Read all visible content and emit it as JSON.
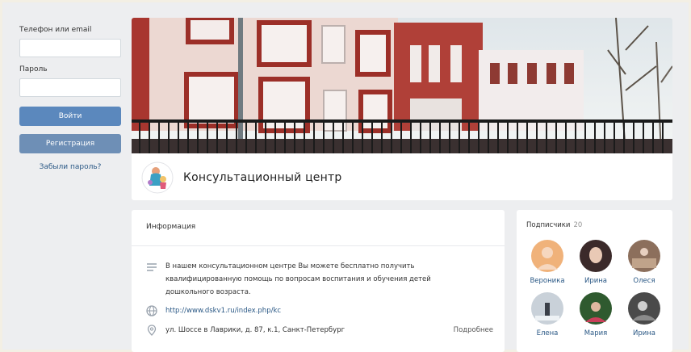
{
  "login": {
    "phone_label": "Телефон или email",
    "phone_value": "",
    "password_label": "Пароль",
    "password_value": "",
    "login_button": "Войти",
    "register_button": "Регистрация",
    "forgot_link": "Забыли пароль?"
  },
  "group": {
    "name": "Консультационный центр"
  },
  "info": {
    "title": "Информация",
    "description": "В нашем консультационном центре Вы можете бесплатно получить квалифицированную помощь по вопросам воспитания и обучения детей дошкольного возраста.",
    "website": "http://www.dskv1.ru/index.php/kc",
    "address": "ул. Шоссе в Лаврики, д. 87, к.1, Санкт-Петербург",
    "more_link": "Подробнее"
  },
  "subscribers": {
    "title": "Подписчики",
    "count": "20",
    "list": [
      {
        "name": "Вероника",
        "color": "#f0b27a"
      },
      {
        "name": "Ирина",
        "color": "#3b2a2a"
      },
      {
        "name": "Олеся",
        "color": "#8c6f5c"
      },
      {
        "name": "Елена",
        "color": "#c9d1d9"
      },
      {
        "name": "Мария",
        "color": "#2f5a2f"
      },
      {
        "name": "Ирина",
        "color": "#4a4a4a"
      }
    ]
  },
  "colors": {
    "accent": "#5b88bd",
    "link": "#2a5885",
    "background": "#edeef0"
  }
}
